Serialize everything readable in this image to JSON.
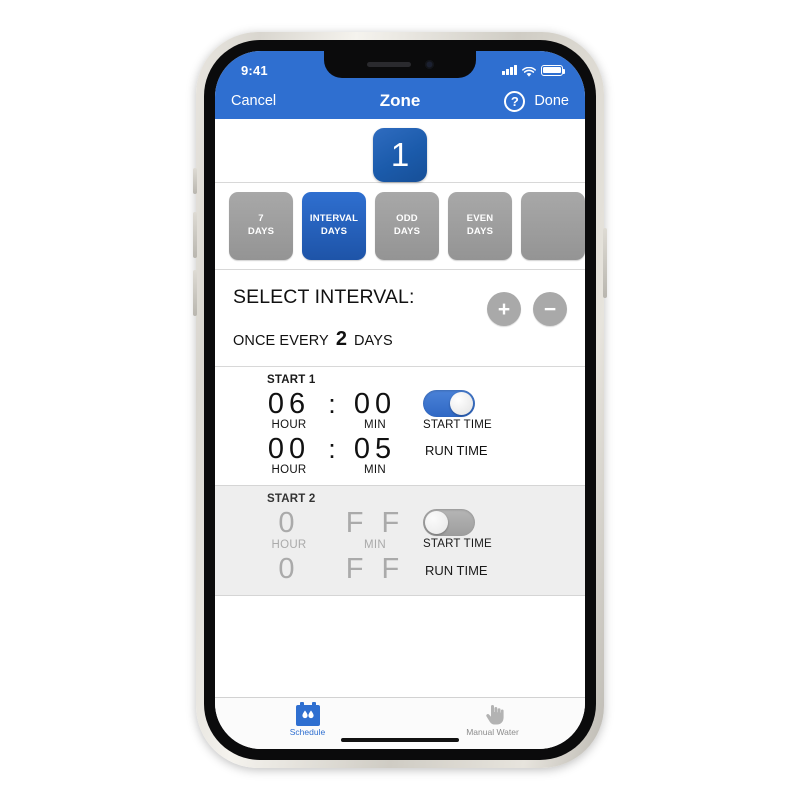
{
  "status_bar": {
    "time": "9:41",
    "signal_icon": "cellular-signal-icon",
    "wifi_icon": "wifi-icon",
    "battery_icon": "battery-full-icon"
  },
  "navbar": {
    "cancel_label": "Cancel",
    "title": "Zone",
    "help_icon": "?",
    "done_label": "Done"
  },
  "zone": {
    "number": "1"
  },
  "mode_tabs": [
    {
      "line1": "7",
      "line2": "DAYS",
      "selected": false
    },
    {
      "line1": "INTERVAL",
      "line2": "DAYS",
      "selected": true
    },
    {
      "line1": "ODD",
      "line2": "DAYS",
      "selected": false
    },
    {
      "line1": "EVEN",
      "line2": "DAYS",
      "selected": false
    },
    {
      "line1": "",
      "line2": "",
      "selected": false
    }
  ],
  "interval": {
    "heading": "SELECT INTERVAL:",
    "prefix": "ONCE EVERY",
    "value": "2",
    "suffix": "DAYS",
    "plus_label": "+",
    "minus_label": "−"
  },
  "starts": [
    {
      "title": "START 1",
      "enabled": true,
      "start_time": {
        "hour": "06",
        "min": "00",
        "hour_unit": "HOUR",
        "min_unit": "MIN",
        "separator": ":",
        "control_label": "START TIME",
        "toggle_on": true
      },
      "run_time": {
        "hour": "00",
        "min": "05",
        "hour_unit": "HOUR",
        "min_unit": "MIN",
        "separator": ":",
        "control_label": "RUN TIME"
      }
    },
    {
      "title": "START 2",
      "enabled": false,
      "start_time": {
        "hour": "0",
        "min": "F F",
        "hour_unit": "HOUR",
        "min_unit": "MIN",
        "separator": ":",
        "control_label": "START TIME",
        "toggle_on": false
      },
      "run_time": {
        "hour": "0",
        "min": "F F",
        "hour_unit": "",
        "min_unit": "",
        "separator": ":",
        "control_label": "RUN TIME"
      }
    }
  ],
  "tabbar": [
    {
      "label": "Schedule",
      "icon": "schedule-calendar-droplets-icon",
      "active": true
    },
    {
      "label": "Manual Water",
      "icon": "pointing-hand-icon",
      "active": false
    }
  ],
  "colors": {
    "brand_blue": "#2f6fd0",
    "zone_badge_blue": "#1b5bab",
    "tab_grey": "#9a9a9a",
    "disabled_grey": "#aaaaaa",
    "disabled_bg": "#eeeeee"
  }
}
